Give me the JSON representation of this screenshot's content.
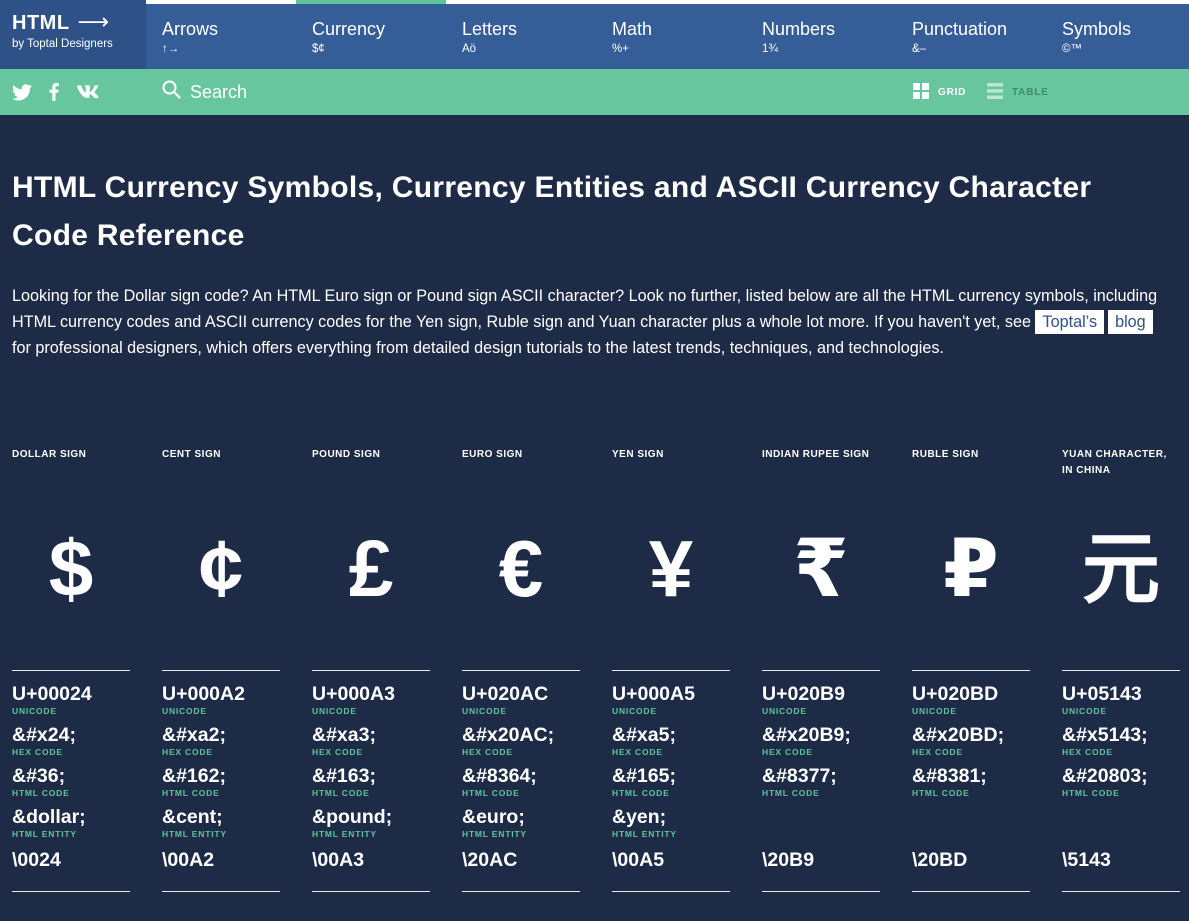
{
  "brand": {
    "title": "HTML",
    "arrow": "⟶",
    "subtitle": "by Toptal Designers"
  },
  "nav": [
    {
      "label": "Arrows",
      "sample": "↑→"
    },
    {
      "label": "Currency",
      "sample": "$¢"
    },
    {
      "label": "Letters",
      "sample": "Aö"
    },
    {
      "label": "Math",
      "sample": "%+"
    },
    {
      "label": "Numbers",
      "sample": "1¾"
    },
    {
      "label": "Punctuation",
      "sample": "&–"
    },
    {
      "label": "Symbols",
      "sample": "©™"
    }
  ],
  "active_nav": "Currency",
  "subbar": {
    "search_label": "Search",
    "grid_label": "GRID",
    "table_label": "TABLE",
    "social": [
      "twitter-icon",
      "facebook-icon",
      "vk-icon"
    ]
  },
  "colors": {
    "background": "#1e2b47",
    "nav": "#355d97",
    "accent": "#68c69f",
    "label": "#5fc49a"
  },
  "page": {
    "title": "HTML Currency Symbols, Currency Entities and ASCII Currency Character Code Reference",
    "intro_text": "Looking for the Dollar sign code? An HTML Euro sign or Pound sign ASCII character? Look no further, listed below are all the HTML currency symbols, including HTML currency codes and ASCII currency codes for the Yen sign, Ruble sign and Yuan character plus a whole lot more. If you haven't yet, see",
    "chip1": "Toptal’s",
    "chip2": "blog",
    "intro_tail": "for professional designers, which offers everything from detailed design tutorials to the latest trends, techniques, and technologies."
  },
  "code_labels": {
    "unicode": "UNICODE",
    "hex": "HEX CODE",
    "html": "HTML CODE",
    "entity": "HTML ENTITY"
  },
  "symbols": [
    {
      "name": "DOLLAR SIGN",
      "glyph": "$",
      "unicode": "U+00024",
      "hex": "&#x24;",
      "html": "&#36;",
      "entity": "&dollar;",
      "css": "\\0024"
    },
    {
      "name": "CENT SIGN",
      "glyph": "¢",
      "unicode": "U+000A2",
      "hex": "&#xa2;",
      "html": "&#162;",
      "entity": "&cent;",
      "css": "\\00A2"
    },
    {
      "name": "POUND SIGN",
      "glyph": "£",
      "unicode": "U+000A3",
      "hex": "&#xa3;",
      "html": "&#163;",
      "entity": "&pound;",
      "css": "\\00A3"
    },
    {
      "name": "EURO SIGN",
      "glyph": "€",
      "unicode": "U+020AC",
      "hex": "&#x20AC;",
      "html": "&#8364;",
      "entity": "&euro;",
      "css": "\\20AC"
    },
    {
      "name": "YEN SIGN",
      "glyph": "¥",
      "unicode": "U+000A5",
      "hex": "&#xa5;",
      "html": "&#165;",
      "entity": "&yen;",
      "css": "\\00A5"
    },
    {
      "name": "INDIAN RUPEE SIGN",
      "glyph": "₹",
      "unicode": "U+020B9",
      "hex": "&#x20B9;",
      "html": "&#8377;",
      "entity": "",
      "css": "\\20B9"
    },
    {
      "name": "RUBLE SIGN",
      "glyph": "₽",
      "unicode": "U+020BD",
      "hex": "&#x20BD;",
      "html": "&#8381;",
      "entity": "",
      "css": "\\20BD"
    },
    {
      "name": "YUAN CHARACTER, IN CHINA",
      "glyph": "元",
      "unicode": "U+05143",
      "hex": "&#x5143;",
      "html": "&#20803;",
      "entity": "",
      "css": "\\5143"
    }
  ]
}
